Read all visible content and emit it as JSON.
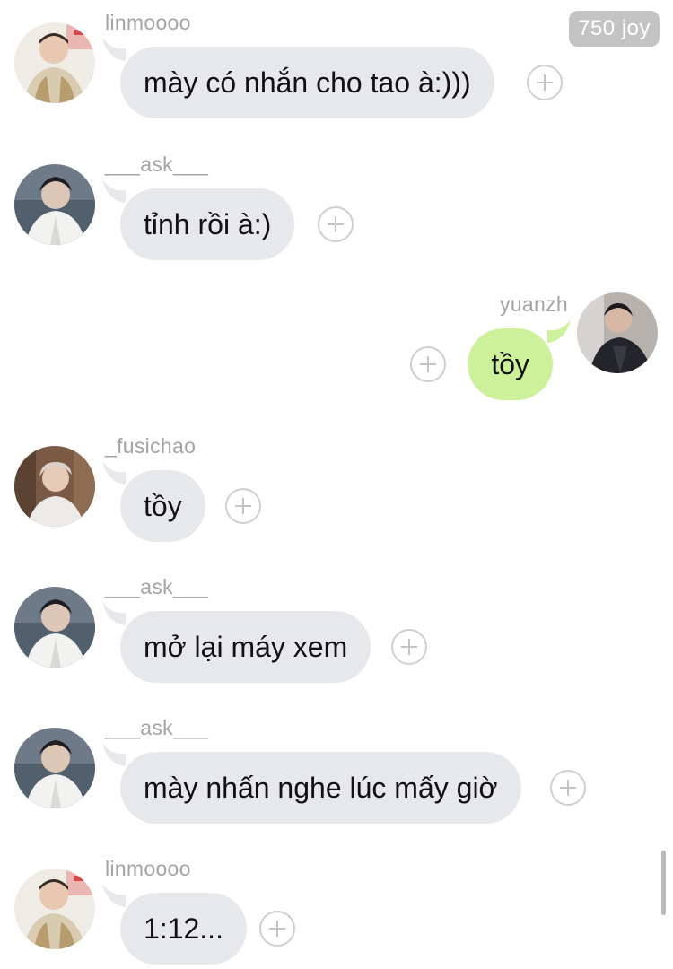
{
  "badge": {
    "label": "750 joy"
  },
  "messages": [
    {
      "sender": "linmoooo",
      "text": "mày có nhắn cho tao à:)))",
      "direction": "in",
      "avatar": "avatar-linmoooo"
    },
    {
      "sender": "___ask___",
      "text": "tỉnh rồi à:)",
      "direction": "in",
      "avatar": "avatar-ask"
    },
    {
      "sender": "yuanzh",
      "text": "tồy",
      "direction": "out",
      "avatar": "avatar-yuanzh"
    },
    {
      "sender": "_fusichao",
      "text": "tồy",
      "direction": "in",
      "avatar": "avatar-fusichao"
    },
    {
      "sender": "___ask___",
      "text": "mở lại máy xem",
      "direction": "in",
      "avatar": "avatar-ask"
    },
    {
      "sender": "___ask___",
      "text": "mày nhấn nghe lúc mấy giờ",
      "direction": "in",
      "avatar": "avatar-ask"
    },
    {
      "sender": "linmoooo",
      "text": "1:12...",
      "direction": "in",
      "avatar": "avatar-linmoooo"
    }
  ],
  "colors": {
    "incoming_bubble": "#e6e8ec",
    "outgoing_bubble": "#cdf19a",
    "sender_text": "#a3a3a3",
    "badge_bg": "#c3c3c3"
  }
}
